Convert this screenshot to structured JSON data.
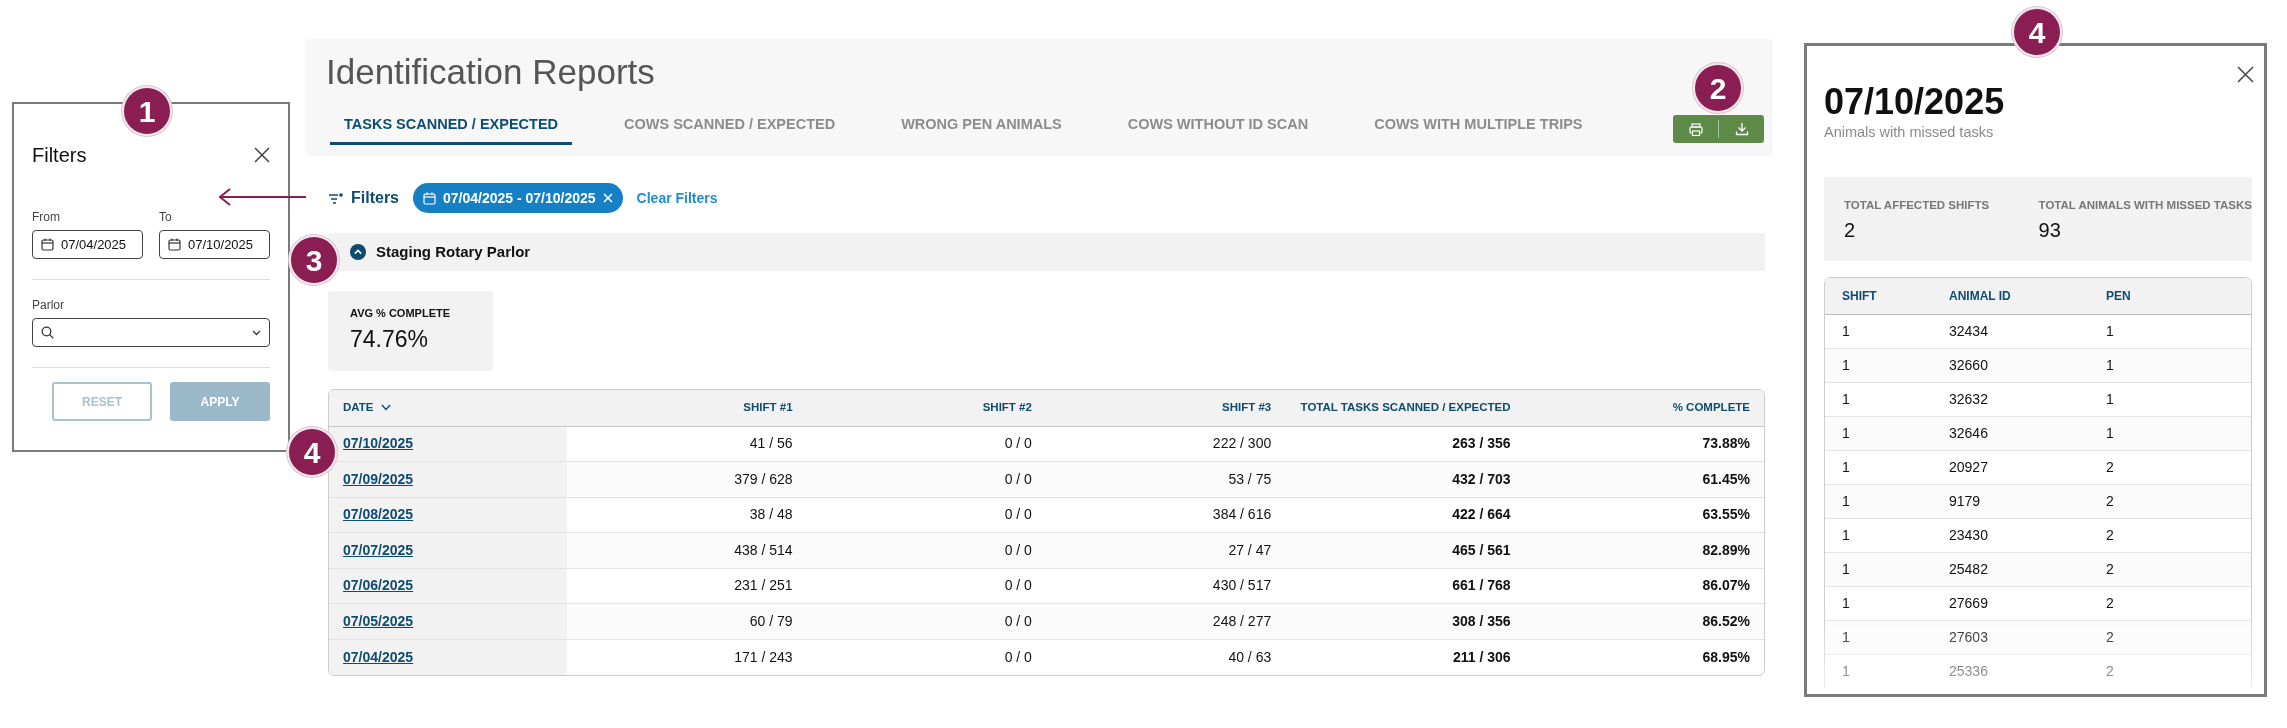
{
  "filters_panel": {
    "callout": "1",
    "title": "Filters",
    "from_label": "From",
    "from_value": "07/04/2025",
    "to_label": "To",
    "to_value": "07/10/2025",
    "parlor_label": "Parlor",
    "buttons": [
      {
        "label": "RESET",
        "kind": "outline",
        "disabled": true
      },
      {
        "label": "APPLY",
        "kind": "solid",
        "disabled": true
      }
    ]
  },
  "report": {
    "title": "Identification Reports",
    "toolbar_callout": "2",
    "tabs": [
      {
        "label": "TASKS SCANNED / EXPECTED",
        "selected": true
      },
      {
        "label": "COWS SCANNED / EXPECTED",
        "selected": false
      },
      {
        "label": "WRONG PEN ANIMALS",
        "selected": false
      },
      {
        "label": "COWS WITHOUT ID SCAN",
        "selected": false
      },
      {
        "label": "COWS WITH MULTIPLE TRIPS",
        "selected": false
      }
    ],
    "filter_bar": {
      "label": "Filters",
      "chip": "07/04/2025 - 07/10/2025",
      "clear": "Clear Filters"
    },
    "section": {
      "callout": "3",
      "title": "Staging Rotary Parlor",
      "expanded": true
    },
    "stat": {
      "label": "AVG % COMPLETE",
      "value": "74.76%"
    },
    "table": {
      "callout": "4",
      "columns": [
        {
          "label": "DATE",
          "sorted": true,
          "kind": "link"
        },
        {
          "label": "SHIFT #1",
          "sorted": false,
          "kind": "plain"
        },
        {
          "label": "SHIFT #2",
          "sorted": false,
          "kind": "plain"
        },
        {
          "label": "SHIFT #3",
          "sorted": false,
          "kind": "plain"
        },
        {
          "label": "TOTAL TASKS SCANNED / EXPECTED",
          "sorted": false,
          "kind": "bold"
        },
        {
          "label": "% COMPLETE",
          "sorted": false,
          "kind": "bold"
        }
      ],
      "rows": [
        [
          "07/10/2025",
          "41 / 56",
          "0 / 0",
          "222 / 300",
          "263 / 356",
          "73.88%"
        ],
        [
          "07/09/2025",
          "379 / 628",
          "0 / 0",
          "53 / 75",
          "432 / 703",
          "61.45%"
        ],
        [
          "07/08/2025",
          "38 / 48",
          "0 / 0",
          "384 / 616",
          "422 / 664",
          "63.55%"
        ],
        [
          "07/07/2025",
          "438 / 514",
          "0 / 0",
          "27 / 47",
          "465 / 561",
          "82.89%"
        ],
        [
          "07/06/2025",
          "231 / 251",
          "0 / 0",
          "430 / 517",
          "661 / 768",
          "86.07%"
        ],
        [
          "07/05/2025",
          "60 / 79",
          "0 / 0",
          "248 / 277",
          "308 / 356",
          "86.52%"
        ],
        [
          "07/04/2025",
          "171 / 243",
          "0 / 0",
          "40 / 63",
          "211 / 306",
          "68.95%"
        ]
      ]
    }
  },
  "detail_panel": {
    "callout": "4",
    "title": "07/10/2025",
    "subtitle": "Animals with missed tasks",
    "stats": [
      {
        "label": "TOTAL AFFECTED SHIFTS",
        "value": "2"
      },
      {
        "label": "TOTAL ANIMALS WITH MISSED TASKS",
        "value": "93"
      }
    ],
    "table": {
      "columns": [
        "SHIFT",
        "ANIMAL ID",
        "PEN"
      ],
      "rows": [
        [
          "1",
          "32434",
          "1"
        ],
        [
          "1",
          "32660",
          "1"
        ],
        [
          "1",
          "32632",
          "1"
        ],
        [
          "1",
          "32646",
          "1"
        ],
        [
          "1",
          "20927",
          "2"
        ],
        [
          "1",
          "9179",
          "2"
        ],
        [
          "1",
          "23430",
          "2"
        ],
        [
          "1",
          "25482",
          "2"
        ],
        [
          "1",
          "27669",
          "2"
        ],
        [
          "1",
          "27603",
          "2"
        ],
        [
          "1",
          "25336",
          "2"
        ]
      ]
    }
  }
}
